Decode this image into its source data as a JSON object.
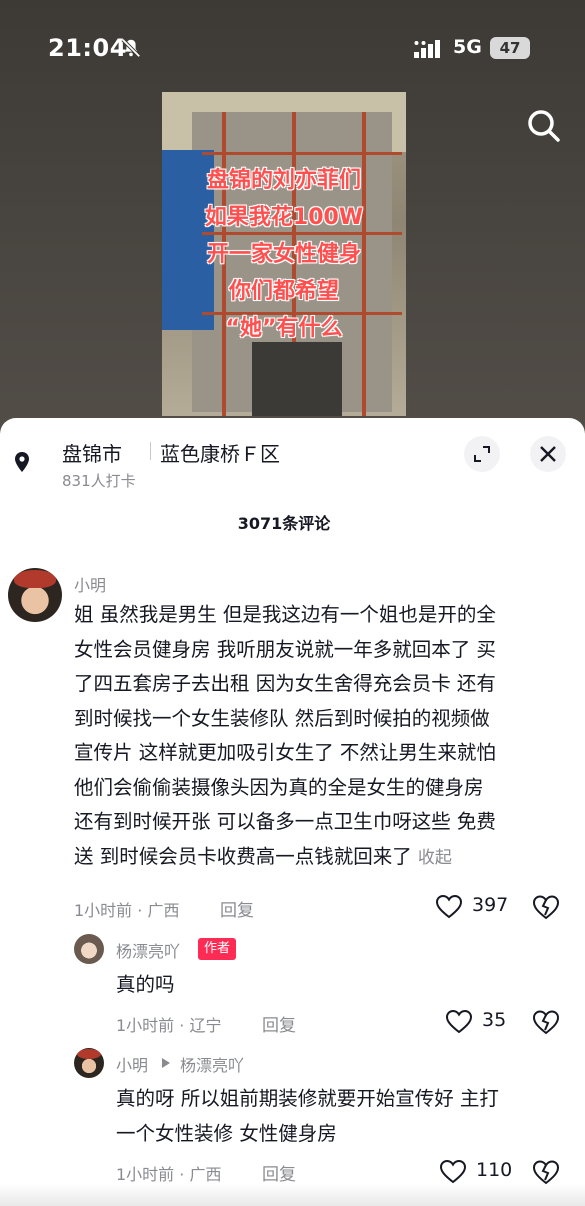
{
  "status": {
    "time": "21:04",
    "network": "5G",
    "battery": "47"
  },
  "video": {
    "overlay_lines": [
      "盘锦的刘亦菲们",
      "如果我花100W",
      "开一家女性健身",
      "你们都希望",
      "“她”有什么"
    ]
  },
  "location": {
    "city": "盘锦市",
    "place": "蓝色康桥Ｆ区",
    "checkins": "831人打卡"
  },
  "comments_header": "3071条评论",
  "comments": [
    {
      "user": "小明",
      "lines": [
        "姐 虽然我是男生 但是我这边有一个姐也是开的全",
        "女性会员健身房 我听朋友说就一年多就回本了 买",
        "了四五套房子去出租 因为女生舍得充会员卡  还有",
        "到时候找一个女生装修队 然后到时候拍的视频做",
        "宣传片 这样就更加吸引女生了 不然让男生来就怕",
        "他们会偷偷装摄像头因为真的全是女生的健身房",
        "还有到时候开张 可以备多一点卫生巾呀这些 免费",
        "送 到时候会员卡收费高一点钱就回来了"
      ],
      "collapse": "收起",
      "meta": "1小时前 · 广西",
      "reply": "回复",
      "likes": "397"
    },
    {
      "user": "杨漂亮吖",
      "tag": "作者",
      "text": "真的吗",
      "meta": "1小时前 · 辽宁",
      "reply": "回复",
      "likes": "35"
    },
    {
      "user": "小明",
      "reply_to": "杨漂亮吖",
      "lines": [
        "真的呀  所以姐前期装修就要开始宣传好  主打",
        "一个女性装修 女性健身房"
      ],
      "meta": "1小时前 · 广西",
      "reply": "回复",
      "likes": "110"
    }
  ]
}
